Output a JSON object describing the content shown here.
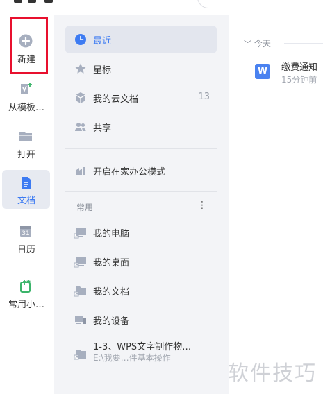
{
  "rail": {
    "items": [
      {
        "label": "新建",
        "icon": "plus-circle-icon"
      },
      {
        "label": "从模板…",
        "icon": "template-icon"
      },
      {
        "label": "打开",
        "icon": "folder-icon"
      },
      {
        "label": "文档",
        "icon": "document-icon"
      },
      {
        "label": "日历",
        "icon": "calendar-icon"
      },
      {
        "label": "常用小…",
        "icon": "tools-icon"
      }
    ],
    "calendar_day": "31"
  },
  "panel": {
    "nav": [
      {
        "label": "最近",
        "icon": "clock-icon"
      },
      {
        "label": "星标",
        "icon": "star-icon"
      },
      {
        "label": "我的云文档",
        "icon": "cloud-box-icon",
        "count": "13"
      },
      {
        "label": "共享",
        "icon": "people-icon"
      }
    ],
    "home_mode": {
      "label": "开启在家办公模式",
      "icon": "home-office-icon"
    },
    "common_title": "常用",
    "common_more": "⋮",
    "common": [
      {
        "label": "我的电脑",
        "icon": "computer-shortcut-icon"
      },
      {
        "label": "我的桌面",
        "icon": "desktop-shortcut-icon"
      },
      {
        "label": "我的文档",
        "icon": "folder-shortcut-icon"
      },
      {
        "label": "我的设备",
        "icon": "device-icon"
      }
    ],
    "recent_folder": {
      "label": "1-3、WPS文字制作物…",
      "path": "E:\\我要…件基本操作",
      "icon": "folder-shortcut-icon"
    }
  },
  "content": {
    "group_label": "今天",
    "doc": {
      "title": "缴费通知",
      "time": "15分钟前",
      "icon_letter": "W"
    }
  },
  "watermark": "软件技巧",
  "colors": {
    "accent": "#3d7bf2",
    "highlight": "#e8102e",
    "icon_gray": "#a7afbf",
    "green": "#3bb46a"
  }
}
